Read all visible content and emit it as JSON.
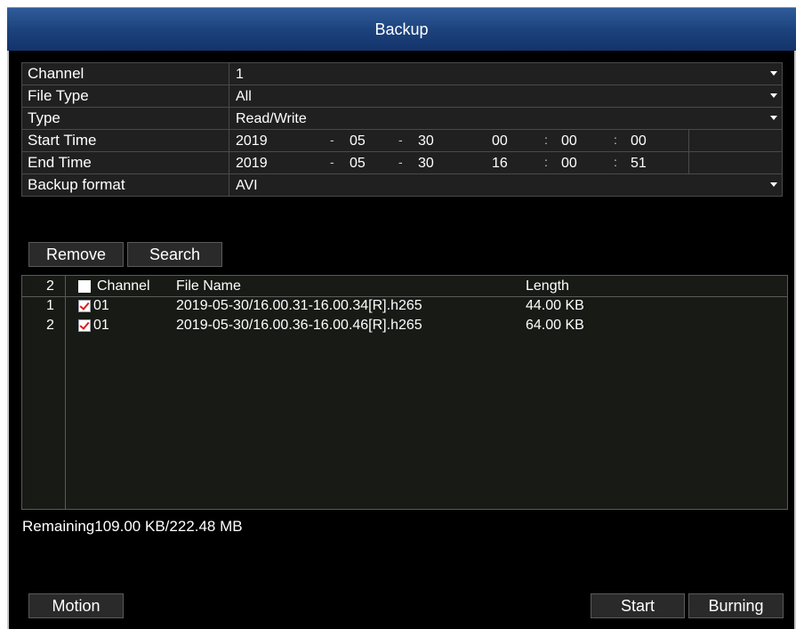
{
  "window": {
    "title": "Backup"
  },
  "form": {
    "channel": {
      "label": "Channel",
      "value": "1"
    },
    "file_type": {
      "label": "File Type",
      "value": "All"
    },
    "type": {
      "label": "Type",
      "value": "Read/Write"
    },
    "start_time": {
      "label": "Start Time",
      "year": "2019",
      "month": "05",
      "day": "30",
      "hour": "00",
      "minute": "00",
      "second": "00"
    },
    "end_time": {
      "label": "End Time",
      "year": "2019",
      "month": "05",
      "day": "30",
      "hour": "16",
      "minute": "00",
      "second": "51"
    },
    "backup_format": {
      "label": "Backup format",
      "value": "AVI"
    }
  },
  "separators": {
    "date": "-",
    "time": ":"
  },
  "actions": {
    "remove": "Remove",
    "search": "Search"
  },
  "file_list": {
    "count": "2",
    "columns": {
      "channel": "Channel",
      "file_name": "File Name",
      "length": "Length"
    },
    "rows": [
      {
        "index": "1",
        "channel": "01",
        "file_name": "2019-05-30/16.00.31-16.00.34[R].h265",
        "length": "44.00 KB",
        "checked": true
      },
      {
        "index": "2",
        "channel": "01",
        "file_name": "2019-05-30/16.00.36-16.00.46[R].h265",
        "length": "64.00 KB",
        "checked": true
      }
    ]
  },
  "status": {
    "remaining": "Remaining109.00 KB/222.48 MB"
  },
  "footer": {
    "motion": "Motion",
    "start": "Start",
    "burning": "Burning"
  },
  "colors": {
    "title_bar": "#1d437d",
    "background": "#000000",
    "check_mark": "#d81d1d"
  }
}
